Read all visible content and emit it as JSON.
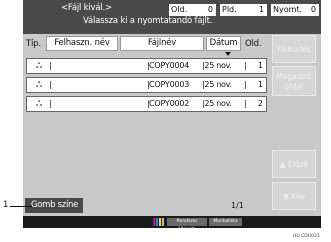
{
  "header": {
    "title": "<Fájl kivál.>",
    "subtitle": "Válassza ki a nyomtatandó fájlt.",
    "counters": [
      {
        "label": "Old.",
        "value": "0"
      },
      {
        "label": "Pld.",
        "value": "1"
      },
      {
        "label": "Nyomt.",
        "value": "0"
      }
    ]
  },
  "columns": {
    "type": "Típ.",
    "user": "Felhaszn. név",
    "file": "Fájlnév",
    "date": "Dátum",
    "pages": "Old."
  },
  "rows": [
    {
      "icon": "ஃ",
      "user": "",
      "file": "COPY0004",
      "date": "25 nov.",
      "pages": "1"
    },
    {
      "icon": "ஃ",
      "user": "",
      "file": "COPY0003",
      "date": "25 nov.",
      "pages": "1"
    },
    {
      "icon": "ஃ",
      "user": "",
      "file": "COPY0002",
      "date": "25 nov.",
      "pages": "2"
    }
  ],
  "side_buttons": {
    "delete": "Fájltörlés",
    "details": [
      "Megadott",
      "oldal"
    ],
    "prev": "▲  Előző",
    "next": "▼  Köv"
  },
  "bottom": {
    "color_button": "Gomb színe",
    "page_indicator": "1/1"
  },
  "status_bar": {
    "btn1": "Rendszer állapota",
    "btn2": "Munkalista"
  },
  "callout_number": "1",
  "figure_code": "HU CDH025"
}
